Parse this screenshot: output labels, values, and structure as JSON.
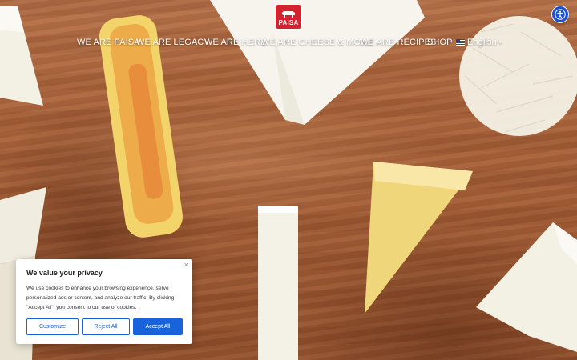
{
  "brand": {
    "logo_text": "PAISA"
  },
  "nav": {
    "items": [
      "WE ARE PAISA",
      "WE ARE LEGACY",
      "WE ARE HERE",
      "WE ARE CHEESE & MORE",
      "WE ARE RECIPES",
      "SHOP"
    ],
    "language": "English"
  },
  "accessibility_button": {
    "icon": "accessibility-icon"
  },
  "hero": {
    "image": "assorted cheeses on wooden board"
  },
  "cookie_banner": {
    "title": "We value your privacy",
    "body": "We use cookies to enhance your browsing experience, serve personalized ads or content, and analyze our traffic. By clicking \"Accept All\", you consent to our use of cookies.",
    "close_label": "×",
    "buttons": {
      "customize": "Customize",
      "reject": "Reject All",
      "accept": "Accept All"
    }
  },
  "colors": {
    "brand_red": "#d3232f",
    "cookie_blue": "#1863dc",
    "a11y_blue": "#1a4fd6"
  }
}
